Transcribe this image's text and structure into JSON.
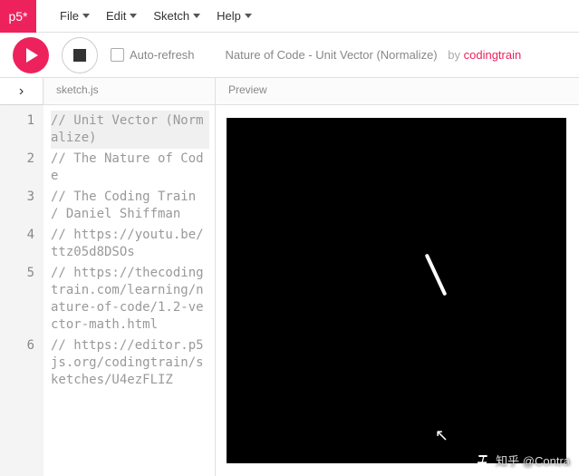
{
  "logo": "p5*",
  "menu": {
    "file": "File",
    "edit": "Edit",
    "sketch": "Sketch",
    "help": "Help"
  },
  "toolbar": {
    "auto_refresh": "Auto-refresh",
    "sketch_title": "Nature of Code - Unit Vector (Normalize)",
    "by": "by",
    "author": "codingtrain"
  },
  "tabs": {
    "file": "sketch.js",
    "preview": "Preview"
  },
  "code": {
    "lines": [
      {
        "n": "1",
        "t": "// Unit Vector (Normalize)",
        "sel": true
      },
      {
        "n": "2",
        "t": "// The Nature of Code"
      },
      {
        "n": "3",
        "t": "// The Coding Train / Daniel Shiffman"
      },
      {
        "n": "4",
        "t": "// https://youtu.be/ttz05d8DSOs"
      },
      {
        "n": "5",
        "t": "// https://thecodingtrain.com/learning/nature-of-code/1.2-vector-math.html"
      },
      {
        "n": "6",
        "t": "// https://editor.p5js.org/codingtrain/sketches/U4ezFLIZ"
      }
    ]
  },
  "watermark": "知乎 @Contra"
}
